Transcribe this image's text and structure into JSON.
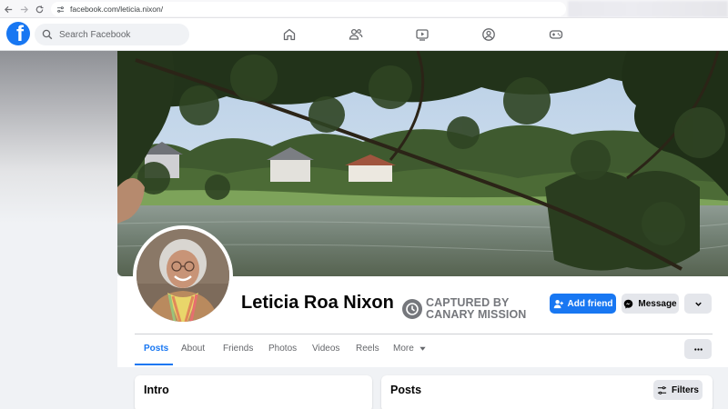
{
  "browser": {
    "url": "facebook.com/leticia.nixon/"
  },
  "header": {
    "logo_letter": "f",
    "search_placeholder": "Search Facebook",
    "nav_icons": [
      "home-icon",
      "friends-icon",
      "watch-icon",
      "groups-icon",
      "gaming-icon"
    ]
  },
  "profile": {
    "name": "Leticia Roa Nixon",
    "badge_line1": "CAPTURED BY",
    "badge_line2": "CANARY MISSION"
  },
  "actions": {
    "add_friend": "Add friend",
    "message": "Message"
  },
  "tabs": [
    {
      "label": "Posts",
      "active": true
    },
    {
      "label": "About"
    },
    {
      "label": "Friends"
    },
    {
      "label": "Photos"
    },
    {
      "label": "Videos"
    },
    {
      "label": "Reels"
    },
    {
      "label": "More"
    }
  ],
  "cards": {
    "intro_title": "Intro",
    "posts_title": "Posts",
    "filters_label": "Filters"
  },
  "colors": {
    "brand": "#1877f2",
    "badge_gray": "#75777c"
  }
}
